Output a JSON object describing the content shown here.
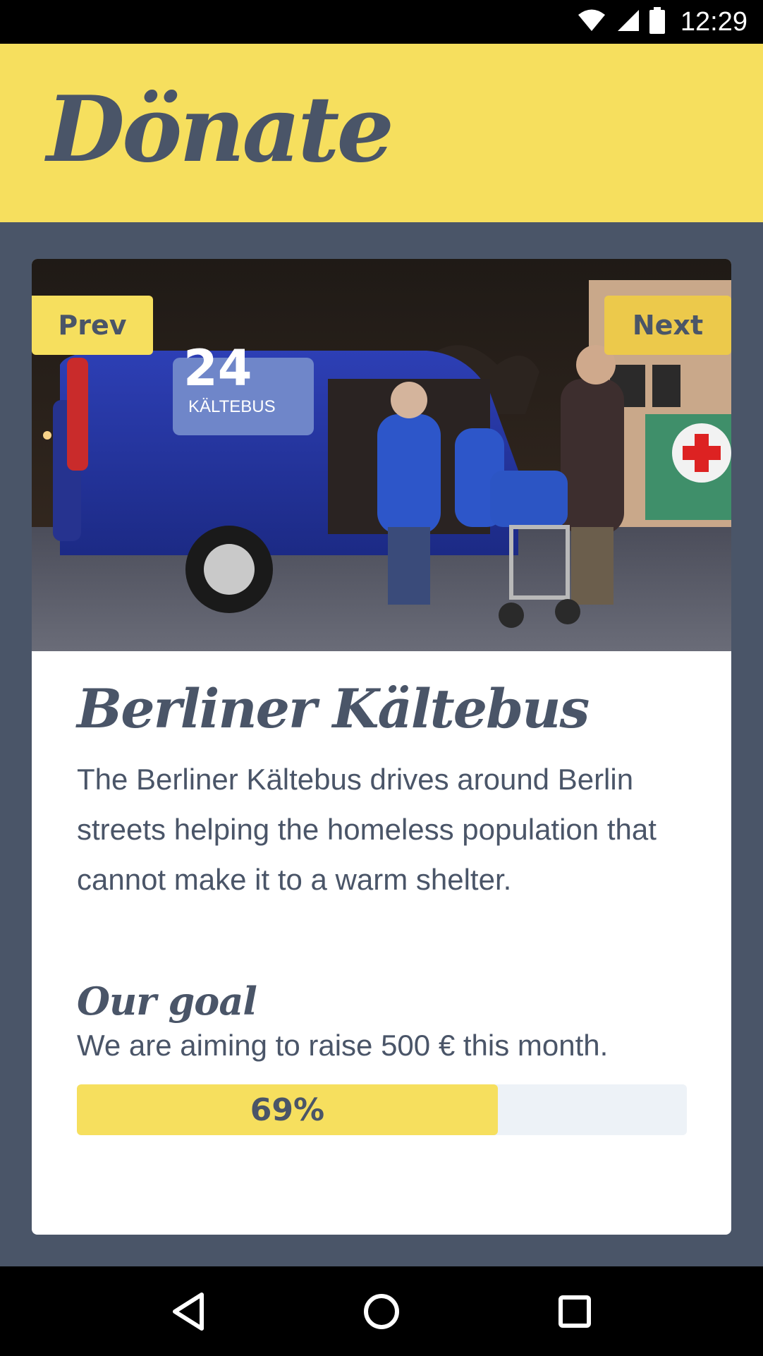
{
  "status_bar": {
    "time": "12:29"
  },
  "header": {
    "logo": "Dönate"
  },
  "carousel": {
    "prev_label": "Prev",
    "next_label": "Next",
    "image_text": {
      "van_number": "24",
      "van_label": "KÄLTEBUS"
    }
  },
  "card": {
    "title": "Berliner Kältebus",
    "description": "The Berliner Kältebus drives around Berlin streets helping the homeless population that cannot make it to a warm shelter."
  },
  "goal": {
    "title": "Our goal",
    "text": "We are aiming to raise 500 € this month.",
    "progress_label": "69%",
    "progress_fraction": 0.69
  },
  "colors": {
    "accent": "#f6df5e",
    "accent_dark": "#ecc94b",
    "slate": "#4a5568",
    "track": "#edf2f7"
  },
  "icons": {
    "status": [
      "wifi-icon",
      "signal-icon",
      "battery-icon"
    ],
    "nav": [
      "back-icon",
      "home-icon",
      "recents-icon"
    ]
  }
}
